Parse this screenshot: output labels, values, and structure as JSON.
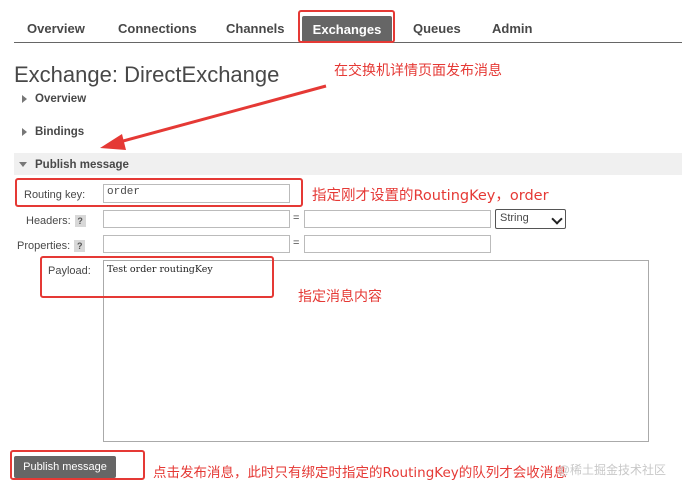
{
  "nav": {
    "tabs": [
      {
        "label": "Overview",
        "active": false
      },
      {
        "label": "Connections",
        "active": false
      },
      {
        "label": "Channels",
        "active": false
      },
      {
        "label": "Exchanges",
        "active": true
      },
      {
        "label": "Queues",
        "active": false
      },
      {
        "label": "Admin",
        "active": false
      }
    ]
  },
  "page": {
    "title": "Exchange: DirectExchange",
    "sections": {
      "overview": "Overview",
      "bindings": "Bindings",
      "publish": "Publish message"
    }
  },
  "form": {
    "routing_key_label": "Routing key:",
    "routing_key_value": "order",
    "headers_label": "Headers:",
    "properties_label": "Properties:",
    "help": "?",
    "equals": "=",
    "type_select": "String",
    "payload_label": "Payload:",
    "payload_value": "Test order routingKey",
    "publish_button": "Publish message"
  },
  "annotations": {
    "a1": "在交换机详情页面发布消息",
    "a2": "指定刚才设置的RoutingKey，order",
    "a3": "指定消息内容",
    "a4": "点击发布消息，此时只有绑定时指定的RoutingKey的队列才会收消息"
  },
  "watermark": "@稀土掘金技术社区",
  "colors": {
    "accent": "#666666",
    "annotation": "#e53935"
  }
}
